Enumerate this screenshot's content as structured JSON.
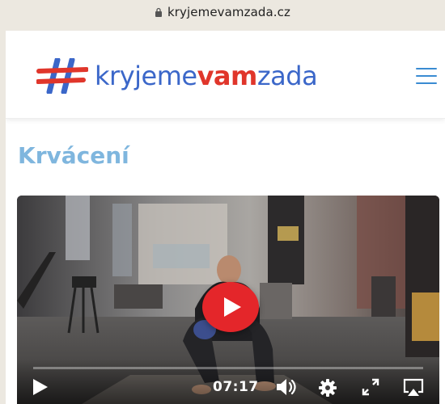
{
  "browser": {
    "url": "kryjemevamzada.cz",
    "lock_icon": "lock-icon"
  },
  "header": {
    "logo_mark_icon": "hashtag-logo-icon",
    "logo_prefix": "kryjeme",
    "logo_accent": "vam",
    "logo_suffix": "zada",
    "menu_icon": "hamburger-menu-icon",
    "colors": {
      "blue": "#3b67c9",
      "red": "#e0362b",
      "menu": "#3a8bd2"
    }
  },
  "main": {
    "title": "Krvácení",
    "title_color": "#7fb6de"
  },
  "video": {
    "time": "07:17",
    "play_icon": "play-icon",
    "volume_icon": "volume-icon",
    "settings_icon": "gear-icon",
    "fullscreen_icon": "fullscreen-icon",
    "airplay_icon": "airplay-icon",
    "play_button_color": "#e4262a"
  }
}
